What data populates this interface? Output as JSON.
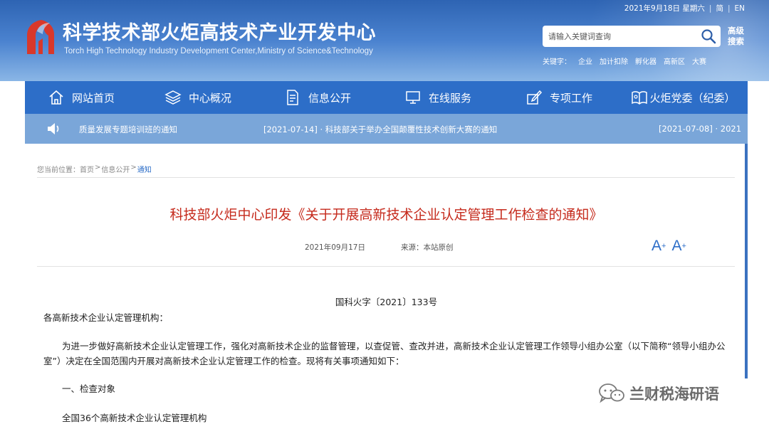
{
  "topbar": {
    "date": "2021年9月18日 星期六",
    "lang_simplified": "简",
    "lang_english": "EN"
  },
  "header": {
    "title": "科学技术部火炬高技术产业开发中心",
    "subtitle": "Torch High Technology Industry Development Center,Ministry of Science&Technology"
  },
  "search": {
    "placeholder": "请输入关键词查询",
    "advanced_label": "高级搜索",
    "keywords_label": "关键字：",
    "keywords": [
      "企业",
      "加计扣除",
      "孵化器",
      "高新区",
      "大赛"
    ]
  },
  "nav": {
    "items": [
      {
        "label": "网站首页",
        "icon": "home-icon"
      },
      {
        "label": "中心概况",
        "icon": "layers-icon"
      },
      {
        "label": "信息公开",
        "icon": "document-icon"
      },
      {
        "label": "在线服务",
        "icon": "monitor-icon"
      },
      {
        "label": "专项工作",
        "icon": "edit-box-icon"
      },
      {
        "label": "火炬党委（纪委）",
        "icon": "party-book-icon"
      }
    ]
  },
  "ticker": {
    "items": [
      "质量发展专题培训班的通知",
      "[2021-07-14] · 科技部关于举办全国颠覆性技术创新大赛的通知",
      "[2021-07-08] · 2021"
    ]
  },
  "breadcrumb": {
    "prefix": "您当前位置：",
    "items": [
      "首页",
      "信息公开",
      "通知"
    ],
    "separator": ">"
  },
  "article": {
    "title": "科技部火炬中心印发《关于开展高新技术企业认定管理工作检查的通知》",
    "date": "2021年09月17日",
    "source": "来源：本站原创",
    "doc_number": "国科火字〔2021〕133号",
    "addressee": "各高新技术企业认定管理机构：",
    "paragraph": "为进一步做好高新技术企业认定管理工作，强化对高新技术企业的监督管理，以查促管、查改并进，高新技术企业认定管理工作领导小组办公室（以下简称“领导小组办公室”）决定在全国范围内开展对高新技术企业认定管理工作的检查。现将有关事项通知如下：",
    "section_heading": "一、检查对象",
    "section_text": "全国36个高新技术企业认定管理机构"
  },
  "tools": {
    "font_larger": "A",
    "font_smaller": "A"
  },
  "watermark": {
    "text": "兰财税海研语"
  },
  "colors": {
    "nav_blue": "#2d6ec8",
    "ticker_blue": "#7aa6d9",
    "title_red": "#c52a1c",
    "logo_red": "#d8382b"
  }
}
